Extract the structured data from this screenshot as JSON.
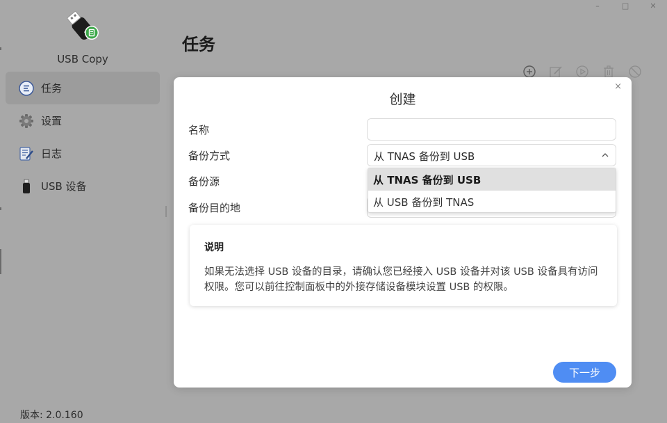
{
  "window": {
    "controls": [
      {
        "name": "minimize",
        "glyph": "–"
      },
      {
        "name": "maximize",
        "glyph": "□"
      },
      {
        "name": "close",
        "glyph": "✕"
      }
    ]
  },
  "app": {
    "name": "USB Copy",
    "version": "版本: 2.0.160"
  },
  "sidebar": {
    "items": [
      {
        "label": "任务",
        "icon": "list-icon",
        "active": true
      },
      {
        "label": "设置",
        "icon": "gear-icon",
        "active": false
      },
      {
        "label": "日志",
        "icon": "log-icon",
        "active": false
      },
      {
        "label": "USB 设备",
        "icon": "usb-drive-icon",
        "active": false
      }
    ]
  },
  "main": {
    "title": "任务",
    "toolbar": [
      "add-icon",
      "edit-icon",
      "play-icon",
      "trash-icon",
      "stop-icon"
    ]
  },
  "modal": {
    "title": "创建",
    "close_glyph": "×",
    "labels": {
      "name": "名称",
      "method": "备份方式",
      "source": "备份源",
      "destination": "备份目的地"
    },
    "name_value": "",
    "method_value": "从 TNAS 备份到 USB",
    "dropdown": {
      "options": [
        "从 TNAS 备份到 USB",
        "从 USB 备份到 TNAS"
      ],
      "selected_index": 0
    },
    "info": {
      "title": "说明",
      "text": "如果无法选择 USB 设备的目录，请确认您已经接入 USB 设备并对该 USB 设备具有访问权限。您可以前往控制面板中的外接存储设备模块设置 USB 的权限。"
    },
    "next_label": "下一步"
  },
  "colors": {
    "accent": "#4f8df3",
    "overlay_bg": "#a8a8a8",
    "active_nav": "#9c9c9c",
    "folder": "#e6bd4a"
  }
}
